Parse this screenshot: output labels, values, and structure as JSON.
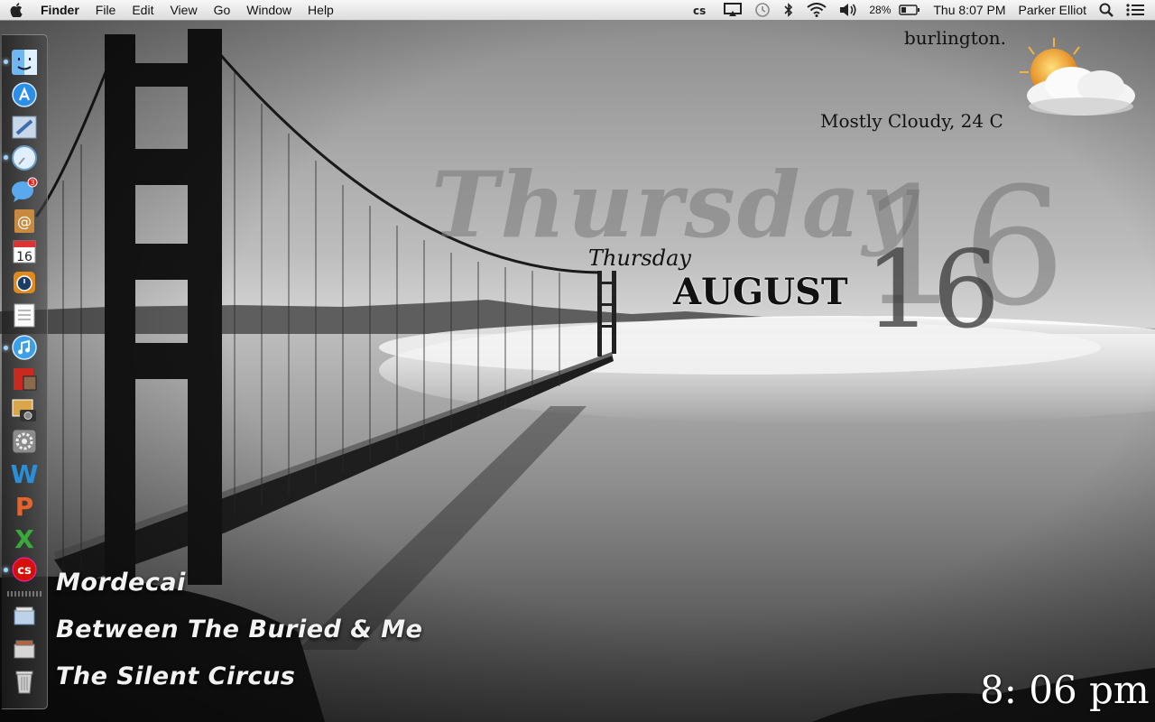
{
  "menubar": {
    "app_name": "Finder",
    "menus": [
      "File",
      "Edit",
      "View",
      "Go",
      "Window",
      "Help"
    ],
    "tray": {
      "battery_percent": "28%",
      "datetime": "Thu 8:07 PM",
      "user": "Parker Elliot",
      "icons": [
        "lastfm-icon",
        "airplay-icon",
        "time-machine-icon",
        "bluetooth-icon",
        "wifi-icon",
        "volume-icon",
        "battery-icon",
        "spotlight-icon",
        "notification-list-icon"
      ]
    }
  },
  "dock": {
    "apps": [
      {
        "name": "finder",
        "running": true
      },
      {
        "name": "app-store",
        "running": false
      },
      {
        "name": "mail",
        "running": false
      },
      {
        "name": "safari",
        "running": true
      },
      {
        "name": "messages",
        "running": false,
        "badge": "3"
      },
      {
        "name": "address-book",
        "running": false
      },
      {
        "name": "calendar",
        "running": false,
        "day": "16"
      },
      {
        "name": "time-utility",
        "running": false
      },
      {
        "name": "notes",
        "running": false
      },
      {
        "name": "itunes",
        "running": true
      },
      {
        "name": "photo-booth",
        "running": false
      },
      {
        "name": "iphoto",
        "running": false
      },
      {
        "name": "system-preferences",
        "running": false
      },
      {
        "name": "word",
        "running": false
      },
      {
        "name": "powerpoint",
        "running": false
      },
      {
        "name": "excel",
        "running": false
      },
      {
        "name": "lastfm",
        "running": true
      },
      {
        "name": "downloads-stack",
        "running": false
      },
      {
        "name": "documents-stack",
        "running": false
      },
      {
        "name": "trash",
        "running": false
      }
    ]
  },
  "weather": {
    "city": "burlington.",
    "description": "Mostly Cloudy, 24 C"
  },
  "date_widget": {
    "big_day": "Thursday",
    "small_day": "Thursday",
    "month": "AUGUST",
    "date_big": "16",
    "date_small": "16"
  },
  "now_playing": {
    "title": "Mordecai",
    "artist": "Between The Buried & Me",
    "album": "The Silent Circus"
  },
  "clock": "8: 06 pm"
}
